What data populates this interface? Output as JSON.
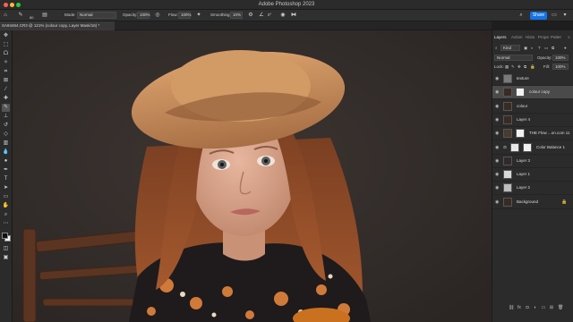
{
  "window": {
    "title": "Adobe Photoshop 2023"
  },
  "options_bar": {
    "brush_size": "80",
    "mode_label": "Mode:",
    "mode_value": "Normal",
    "opacity_label": "Opacity:",
    "opacity_value": "100%",
    "flow_label": "Flow:",
    "flow_value": "100%",
    "smoothing_label": "Smoothing:",
    "smoothing_value": "10%",
    "angle_value": "0°",
    "share_label": "Share"
  },
  "document_tab": {
    "label": "SA94464.CR3 @ 121% (colour copy, Layer Mask/16) *"
  },
  "panel_tabs": [
    "Layers",
    "Action",
    "Histo",
    "Prope",
    "Patter"
  ],
  "layers_panel": {
    "filter_value": "Kind",
    "blend_value": "Normal",
    "opacity_label": "Opacity:",
    "opacity_value": "100%",
    "lock_label": "Lock:",
    "fill_label": "Fill:",
    "fill_value": "100%"
  },
  "layers": [
    {
      "name": "texture",
      "selected": false,
      "mask": false,
      "adjust": false
    },
    {
      "name": "colour copy",
      "selected": true,
      "mask": true,
      "adjust": false
    },
    {
      "name": "colour",
      "selected": false,
      "mask": false,
      "adjust": false
    },
    {
      "name": "Layer 4",
      "selected": false,
      "mask": false,
      "adjust": false
    },
    {
      "name": "THE Flow ...on.com 11",
      "selected": false,
      "mask": true,
      "adjust": false
    },
    {
      "name": "Color Balance 1",
      "selected": false,
      "mask": true,
      "adjust": true
    },
    {
      "name": "Layer 3",
      "selected": false,
      "mask": false,
      "adjust": false
    },
    {
      "name": "Layer 1",
      "selected": false,
      "mask": false,
      "adjust": false
    },
    {
      "name": "Layer 2",
      "selected": false,
      "mask": false,
      "adjust": false
    },
    {
      "name": "Background",
      "selected": false,
      "mask": false,
      "adjust": false,
      "locked": true
    }
  ],
  "icons": {
    "traffic_lights": [
      "#ff5f57",
      "#febc2e",
      "#28c840"
    ],
    "accent": "#1473e6"
  }
}
